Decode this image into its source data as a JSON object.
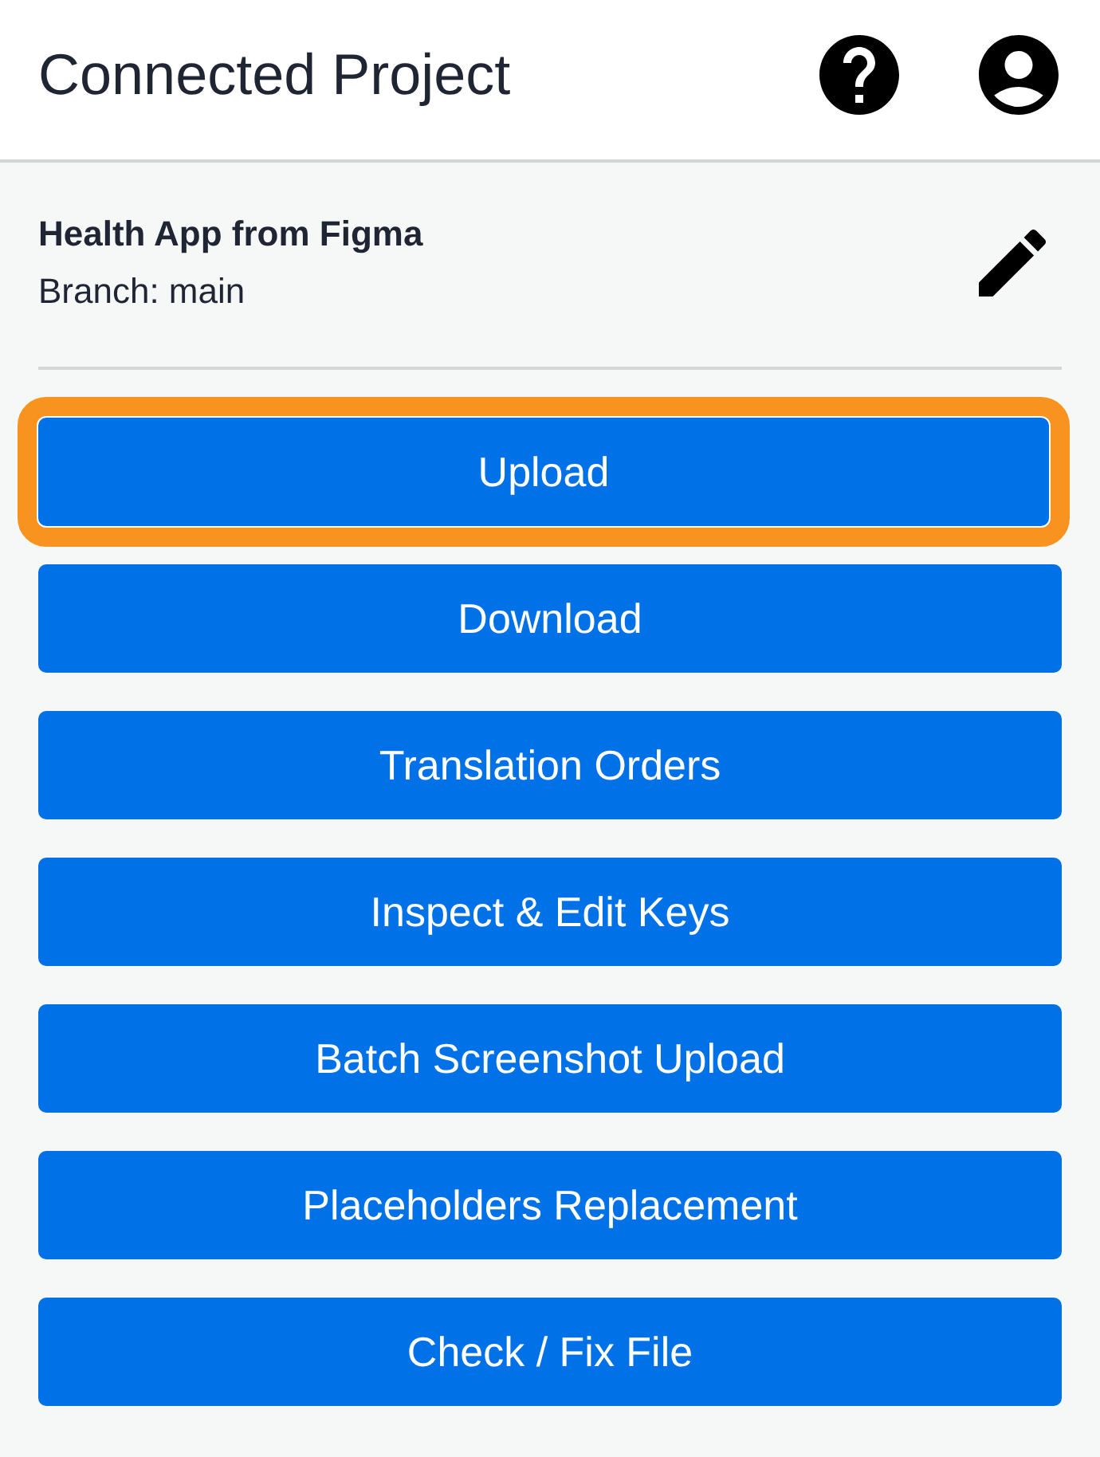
{
  "header": {
    "title": "Connected Project"
  },
  "project": {
    "name": "Health App from Figma",
    "branch": "Branch: main"
  },
  "actions": [
    {
      "label": "Upload",
      "highlighted": true
    },
    {
      "label": "Download",
      "highlighted": false
    },
    {
      "label": "Translation Orders",
      "highlighted": false
    },
    {
      "label": "Inspect & Edit Keys",
      "highlighted": false
    },
    {
      "label": "Batch Screenshot Upload",
      "highlighted": false
    },
    {
      "label": "Placeholders Replacement",
      "highlighted": false
    },
    {
      "label": "Check / Fix File",
      "highlighted": false
    }
  ]
}
